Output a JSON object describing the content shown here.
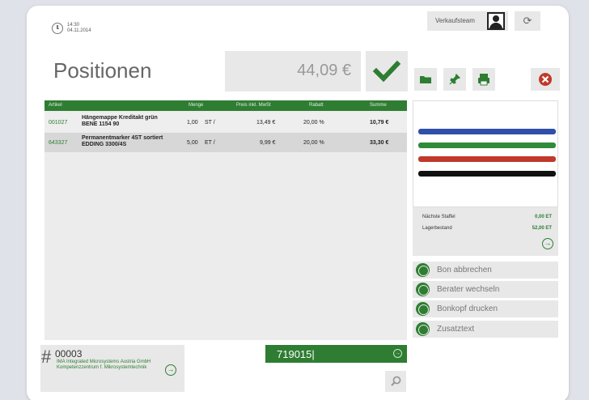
{
  "header": {
    "time": "14:30",
    "date": "04.11.2014",
    "team_label": "Verkaufsteam",
    "page_title": "Positionen",
    "total": "44,09 €"
  },
  "table": {
    "columns": [
      "Artikel",
      "Menge",
      "Preis inkl. MwSt",
      "Rabatt",
      "Summe"
    ],
    "rows": [
      {
        "artikel": "001027",
        "name": "Hängemappe Kreditakt grün",
        "sub": "BENE 1154 90",
        "menge": "1,00",
        "unit": "ST /",
        "preis": "13,49 €",
        "rabatt": "20,00 %",
        "summe": "10,79 €"
      },
      {
        "artikel": "643327",
        "name": "Permanentmarker 4ST sortiert",
        "sub": "EDDING 3300/4S",
        "menge": "5,00",
        "unit": "ET /",
        "preis": "9,99 €",
        "rabatt": "20,00 %",
        "summe": "33,30 €"
      }
    ]
  },
  "product_info": {
    "next_tier_label": "Nächste Staffel",
    "next_tier_value": "0,00 ET",
    "stock_label": "Lagerbestand",
    "stock_value": "52,00 ET",
    "pen_colors": [
      "#2f4fa8",
      "#2f8a3a",
      "#c0392b",
      "#111111"
    ]
  },
  "actions": {
    "cancel_receipt": "Bon abbrechen",
    "change_advisor": "Berater wechseln",
    "print_header": "Bonkopf drucken",
    "extra_text": "Zusatztext"
  },
  "customer": {
    "hash": "#",
    "number": "00003",
    "address": "IMA Integrated Microsystems Austria GmbH Kompetenzzentrum f. Mikrosystemtechnik"
  },
  "scan": {
    "value": "719015|"
  },
  "colors": {
    "accent": "#2e7d32",
    "cancel_red": "#c0392b",
    "panel_gray": "#e8e8e8"
  },
  "icons": {
    "clock": "clock-icon",
    "refresh": "refresh-icon",
    "confirm": "checkmark-icon",
    "folder": "folder-icon",
    "pin": "pin-icon",
    "print": "printer-icon",
    "cancel": "close-circle-icon",
    "search": "search-icon"
  }
}
